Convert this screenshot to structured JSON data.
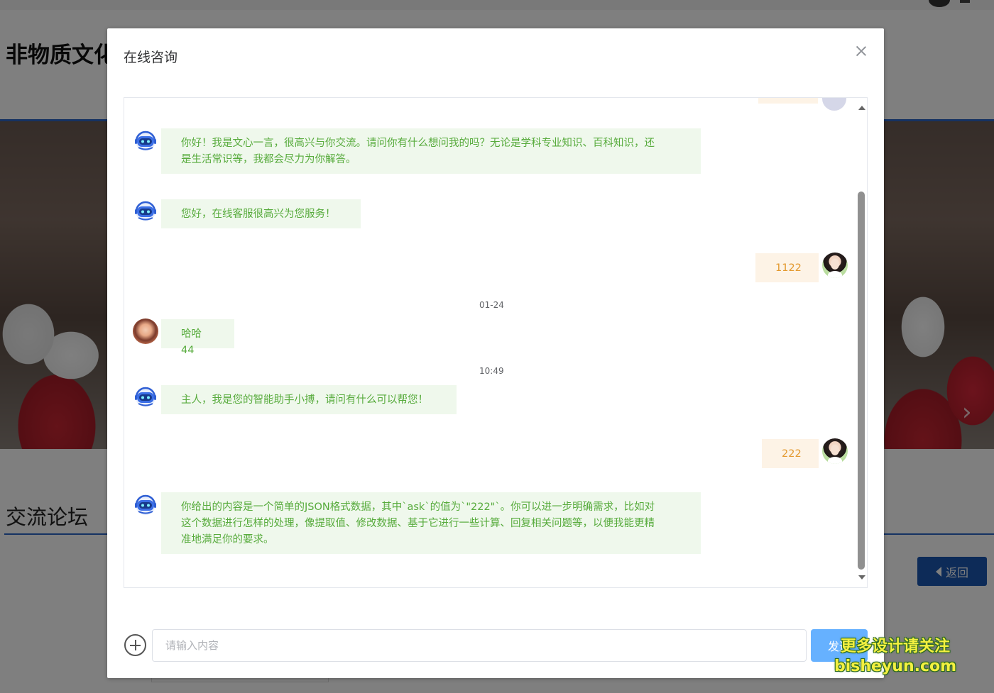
{
  "background": {
    "page_title": "非物质文化",
    "forum_heading": "交流论坛",
    "back_button": "返回"
  },
  "dialog": {
    "title": "在线咨询",
    "close_icon": "close-icon",
    "messages": [
      {
        "side": "left",
        "avatar": "robot-icon",
        "text_lines": [
          "你好！我是文心一言，很高兴与你交流。请问你有什么想问我的吗？无论是学科专业知识、百科知识，还",
          "是生活常识等，我都会尽力为你解答。"
        ]
      },
      {
        "side": "left",
        "avatar": "robot-icon",
        "text_lines": [
          "您好，在线客服很高兴为您服务！"
        ]
      },
      {
        "side": "right",
        "avatar": "user-avatar",
        "text_lines": [
          "1122"
        ]
      },
      {
        "timestamp": "01-24"
      },
      {
        "side": "left",
        "avatar": "other-user-avatar",
        "text_lines": [
          "哈哈44"
        ]
      },
      {
        "timestamp": "10:49"
      },
      {
        "side": "left",
        "avatar": "robot-icon",
        "text_lines": [
          "主人，我是您的智能助手小搏，请问有什么可以帮您！"
        ]
      },
      {
        "side": "right",
        "avatar": "user-avatar",
        "text_lines": [
          "222"
        ]
      },
      {
        "side": "left",
        "avatar": "robot-icon",
        "text_lines": [
          "你给出的内容是一个简单的JSON格式数据，其中`ask`的值为`\"222\"`。你可以进一步明确需求，比如对",
          "这个数据进行怎样的处理，像提取值、修改数据、基于它进行一些计算、回复相关问题等，以便我能更精",
          "准地满足你的要求。"
        ]
      }
    ],
    "input": {
      "placeholder": "请输入内容",
      "value": ""
    },
    "send_button": "发送",
    "add_icon": "plus-circle-icon"
  },
  "watermark": {
    "line1": "更多设计请关注",
    "line2": "bisheyun.com"
  },
  "colors": {
    "bot_bubble_bg": "#eff8ec",
    "bot_text": "#57ab3c",
    "user_bubble_bg": "#fdf3e6",
    "user_text": "#e3992e",
    "send_button_bg": "#66b1ff",
    "accent_blue": "#2b64c4"
  }
}
